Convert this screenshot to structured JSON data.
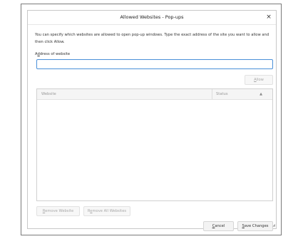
{
  "dialog": {
    "title": "Allowed Websites - Pop-ups",
    "close_glyph": "×",
    "description": "You can specify which websites are allowed to open pop-up windows. Type the exact address of the site you want to allow and then click Allow.",
    "address_label_accesskey": "d",
    "address_label_rest_before": "A",
    "address_label_rest_after": "dress of website",
    "address_input": {
      "value": "",
      "placeholder": ""
    },
    "allow_button": {
      "accesskey": "A",
      "rest": "llow"
    },
    "table": {
      "columns": [
        "Website",
        "Status"
      ],
      "sort_glyph": "▲",
      "rows": []
    },
    "remove_button": {
      "accesskey": "R",
      "rest": "emove Website"
    },
    "remove_all_button": {
      "before": "R",
      "accesskey": "e",
      "rest": "move All Websites"
    },
    "cancel_button": {
      "accesskey": "C",
      "rest": "ancel"
    },
    "save_button": {
      "accesskey": "S",
      "rest": "ave Changes"
    }
  },
  "icons": {
    "close": "close-icon",
    "sort": "sort-ascending-icon",
    "resize": "resize-grip-icon"
  }
}
